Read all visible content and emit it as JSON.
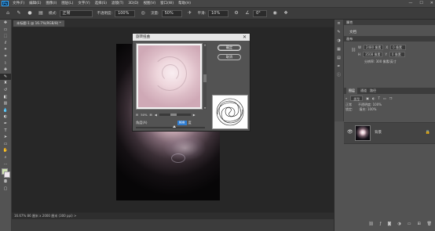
{
  "menubar": {
    "logo": "Ps",
    "items": [
      "文件(F)",
      "编辑(E)",
      "图像(I)",
      "图层(L)",
      "文字(Y)",
      "选择(S)",
      "滤镜(T)",
      "3D(D)",
      "视图(V)",
      "窗口(W)",
      "帮助(H)"
    ],
    "window_controls": [
      "—",
      "☐",
      "✕"
    ]
  },
  "options": {
    "mode_label": "模式:",
    "mode_value": "正常",
    "opacity_label": "不透明度:",
    "opacity_value": "100%",
    "flow_label": "流量:",
    "flow_value": "50%",
    "smooth_label": "平滑:",
    "smooth_value": "10%",
    "angle_value": "0°"
  },
  "document": {
    "tab_label": "未标题-1 @ 16.7%(RGB/8) *",
    "status_text": "16.67%   86 厘米 x 2000 厘米 (300 ppi)   >"
  },
  "dialog": {
    "title": "旋转扭曲",
    "ok_label": "确定",
    "cancel_label": "取消",
    "zoom_value": "50%",
    "angle_label": "角度(A)",
    "angle_value": "999",
    "angle_unit": "度"
  },
  "properties": {
    "tabs": "属性",
    "doc_label": "文档",
    "canvas_label": "画布",
    "width_label": "W",
    "width_value": "2480 像素",
    "x_label": "X",
    "x_value": "0 像素",
    "height_label": "H",
    "height_value": "3508 像素",
    "y_label": "Y",
    "y_value": "0 像素",
    "resolution": "分辨率: 300 像素/英寸"
  },
  "layers": {
    "tab_layers": "图层",
    "tab_channels": "通道",
    "tab_paths": "路径",
    "filter_label": "类型",
    "blend_mode": "正常",
    "opacity_label": "不透明度: 100%",
    "lock_label": "锁定:",
    "fill_label": "填充: 100%",
    "layer_name": "背景"
  },
  "toolbar": {
    "tools": [
      "move-tool",
      "artboard-tool",
      "marquee-tool",
      "lasso-tool",
      "quick-select-tool",
      "crop-tool",
      "eyedropper-tool",
      "healing-tool",
      "brush-tool",
      "stamp-tool",
      "history-brush-tool",
      "eraser-tool",
      "gradient-tool",
      "blur-tool",
      "dodge-tool",
      "pen-tool",
      "type-tool",
      "path-select-tool",
      "shape-tool",
      "hand-tool",
      "zoom-tool"
    ]
  }
}
